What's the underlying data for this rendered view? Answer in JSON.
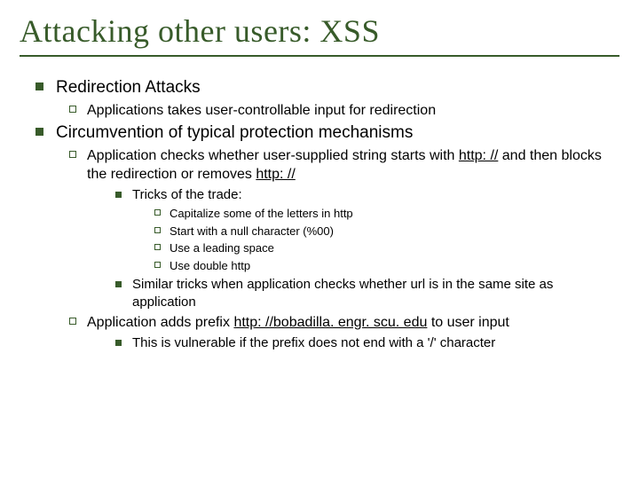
{
  "title": "Attacking other users: XSS",
  "b1": "Redirection Attacks",
  "b1a": "Applications takes user-controllable input for redirection",
  "b2": "Circumvention of typical protection mechanisms",
  "b2a_pre": "Application checks whether user-supplied string starts with ",
  "link_http": "http: //",
  "b2a_mid": " and then blocks the redirection or removes ",
  "b2b": "Tricks of the trade:",
  "t1": "Capitalize some of the letters in http",
  "t2": "Start with a null character (%00)",
  "t3": "Use a leading space",
  "t4": "Use double http",
  "b2c": "Similar tricks when application checks whether url is in the same site as application",
  "b2d_pre": "Application adds prefix ",
  "link_bob": "http: //bobadilla. engr. scu. edu",
  "b2d_post": " to user input",
  "b2e": "This is vulnerable if the prefix does not end with a '/' character"
}
